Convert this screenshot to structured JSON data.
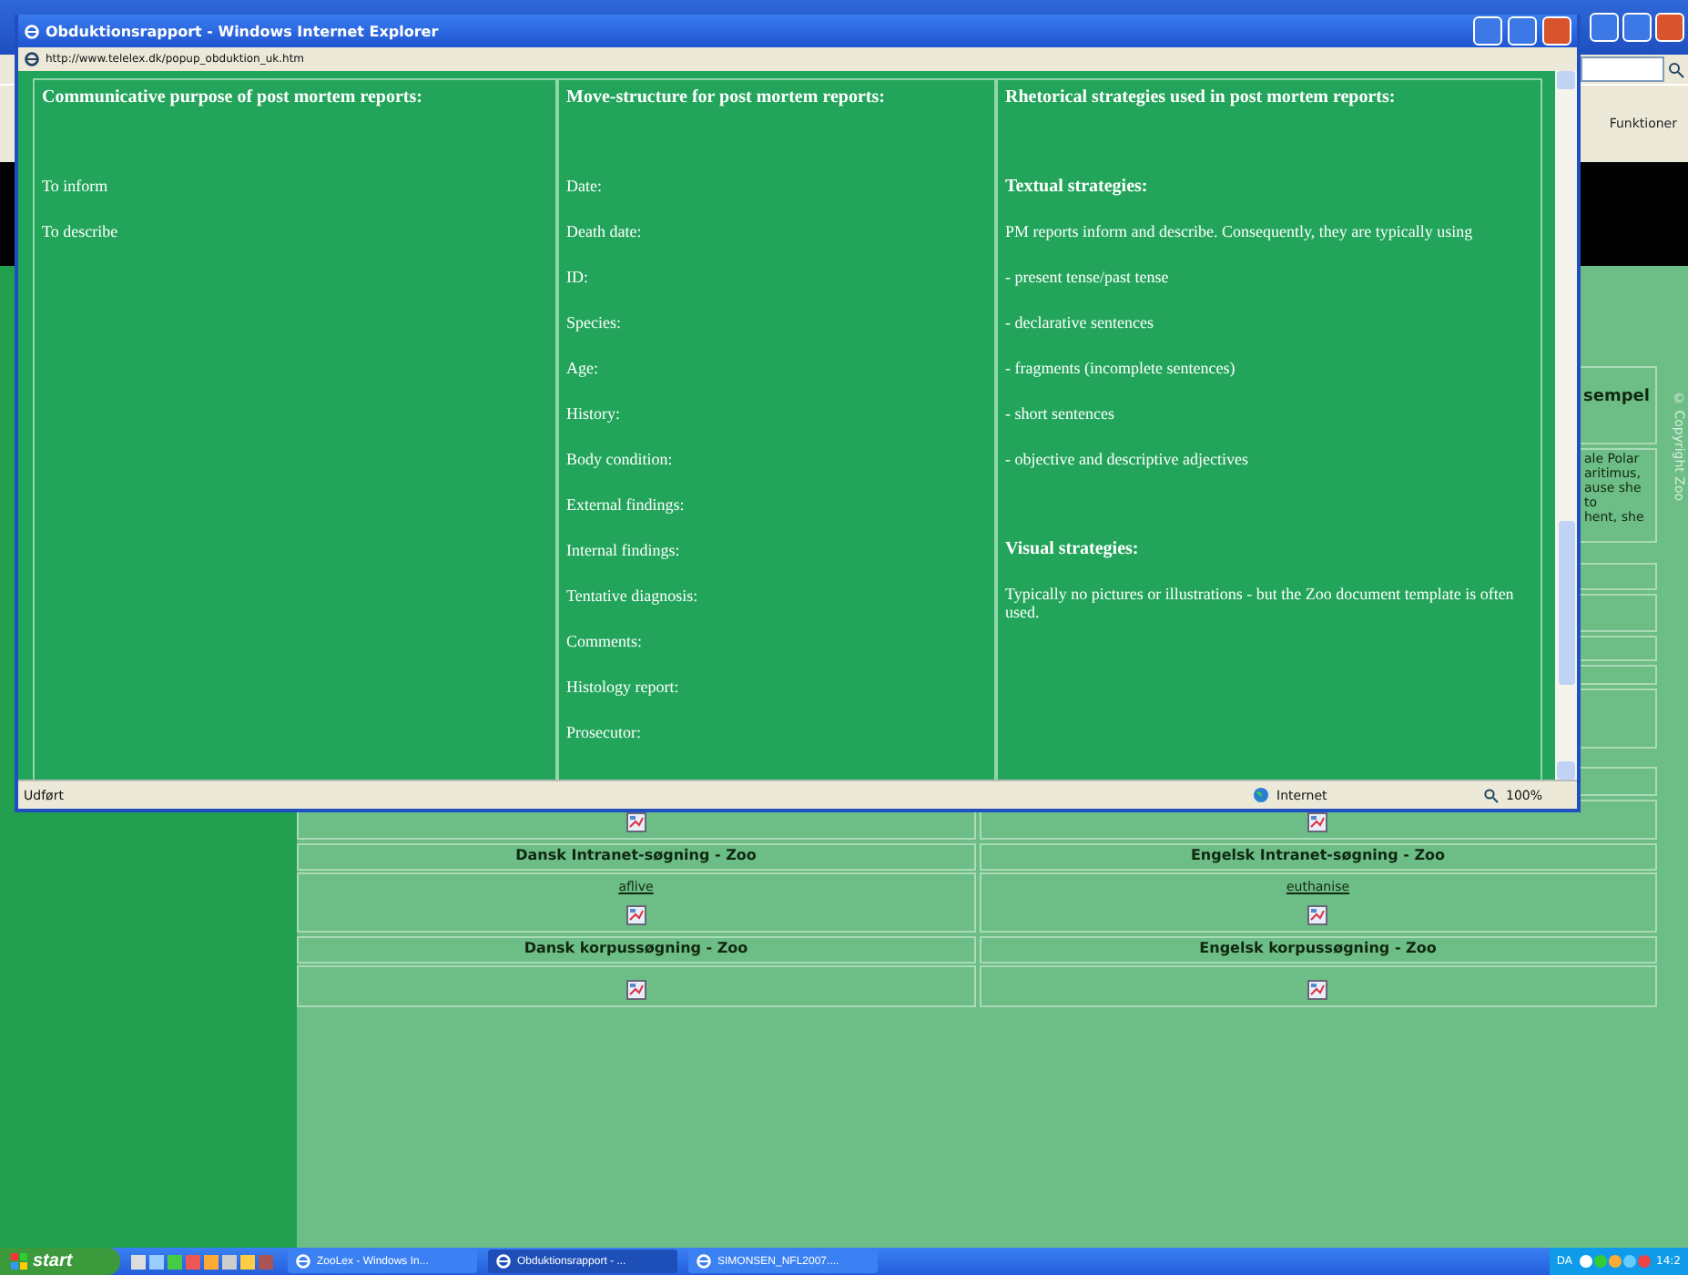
{
  "popup": {
    "title": "Obduktionsrapport - Windows Internet Explorer",
    "address": "http://www.telelex.dk/popup_obduktion_uk.htm",
    "columns": [
      {
        "heading": "Communicative purpose of post mortem reports:",
        "items": [
          {
            "kind": "text",
            "text": "To inform"
          },
          {
            "kind": "text",
            "text": "To describe"
          }
        ]
      },
      {
        "heading": "Move-structure for post mortem reports:",
        "items": [
          {
            "kind": "text",
            "text": "Date:"
          },
          {
            "kind": "text",
            "text": "Death date:"
          },
          {
            "kind": "text",
            "text": "ID:"
          },
          {
            "kind": "text",
            "text": "Species:"
          },
          {
            "kind": "text",
            "text": "Age:"
          },
          {
            "kind": "text",
            "text": "History:"
          },
          {
            "kind": "text",
            "text": "Body condition:"
          },
          {
            "kind": "text",
            "text": "External findings:"
          },
          {
            "kind": "text",
            "text": "Internal findings:"
          },
          {
            "kind": "text",
            "text": "Tentative diagnosis:"
          },
          {
            "kind": "text",
            "text": "Comments:"
          },
          {
            "kind": "text",
            "text": "Histology report:"
          },
          {
            "kind": "text",
            "text": "Prosecutor:"
          }
        ]
      },
      {
        "heading": "Rhetorical strategies used in post mortem reports:",
        "items": [
          {
            "kind": "heading",
            "text": "Textual strategies:"
          },
          {
            "kind": "text",
            "text": "PM reports inform and describe. Consequently, they are typically using"
          },
          {
            "kind": "text",
            "text": "- present tense/past tense"
          },
          {
            "kind": "text",
            "text": "- declarative sentences"
          },
          {
            "kind": "text",
            "text": "- fragments (incomplete sentences)"
          },
          {
            "kind": "text",
            "text": "- short sentences"
          },
          {
            "kind": "text",
            "text": "- objective and descriptive adjectives"
          },
          {
            "kind": "heading",
            "text": "Visual strategies:"
          },
          {
            "kind": "text",
            "text": "Typically no pictures or illustrations - but the Zoo document template is often used."
          }
        ]
      }
    ],
    "status": "Udført",
    "zone": "Internet",
    "zoom": "100%"
  },
  "background": {
    "toolbar_label": "Funktioner",
    "copyright": "© Copyright Zoo",
    "side_heading": "sempel",
    "side_text": [
      "ale Polar",
      "aritimus,",
      "ause she",
      "to",
      "hent, she"
    ],
    "search_rows": [
      {
        "left": {
          "heading": "Dansk Intranet-søgning - Zoo",
          "link": "aflive"
        },
        "right": {
          "heading": "Engelsk Intranet-søgning - Zoo",
          "link": "euthanise"
        }
      },
      {
        "left": {
          "heading": "Dansk korpussøgning - Zoo"
        },
        "right": {
          "heading": "Engelsk korpussøgning - Zoo"
        }
      }
    ]
  },
  "taskbar": {
    "start": "start",
    "tasks": [
      {
        "label": "ZooLex - Windows In...",
        "selected": false
      },
      {
        "label": "Obduktionsrapport - ...",
        "selected": true
      },
      {
        "label": "SIMONSEN_NFL2007....",
        "selected": false
      }
    ],
    "language": "DA",
    "clock": "14:2"
  }
}
